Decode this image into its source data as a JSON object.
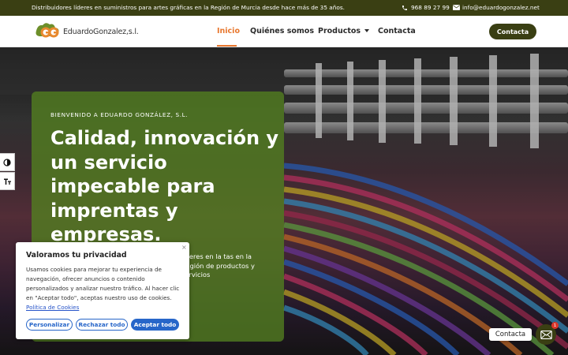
{
  "topbar": {
    "tagline": "Distribuidores líderes en suministros para artes gráficas en la Región de Murcia desde hace más de 35 años.",
    "phone": "968 89 27 99",
    "email": "info@eduardogonzalez.net",
    "icons": [
      "phone-icon",
      "mail-icon"
    ]
  },
  "brand": {
    "name": "EduardoGonzalez,s.l.",
    "colors": {
      "primary": "#3a3f13",
      "accent": "#e8772e",
      "logo_green": "#6d8f2a",
      "logo_orange": "#e8892e"
    }
  },
  "nav": {
    "items": [
      {
        "label": "Inicio",
        "active": true
      },
      {
        "label": "Quiénes somos",
        "active": false
      },
      {
        "label": "Productos",
        "active": false,
        "dropdown": true
      },
      {
        "label": "Contacta",
        "active": false
      }
    ],
    "cta_label": "Contacta"
  },
  "hero": {
    "kicker": "BIENVENIDO A EDUARDO GONZÁLEZ, S.L.",
    "title": "Calidad, innovación y un servicio impecable para imprentas y empresas.",
    "subtitle_visible": "líderes en la tas en la Región de productos y servicios",
    "panel_color": "#538020"
  },
  "accessibility": {
    "icons": [
      "contrast-icon",
      "text-size-icon"
    ]
  },
  "cookie": {
    "close": "×",
    "title": "Valoramos tu privacidad",
    "body": "Usamos cookies para mejorar tu experiencia de navegación, ofrecer anuncios o contenido personalizados y analizar nuestro tráfico. Al hacer clic en \"Aceptar todo\", aceptas nuestro uso de cookies.",
    "policy_link": "Política de Cookies",
    "buttons": {
      "customize": "Personalizar",
      "reject": "Rechazar todo",
      "accept": "Aceptar todo"
    },
    "button_color": "#2766c9"
  },
  "floating_contact": {
    "label": "Contacta",
    "badge": "1",
    "icon": "mail-icon"
  }
}
